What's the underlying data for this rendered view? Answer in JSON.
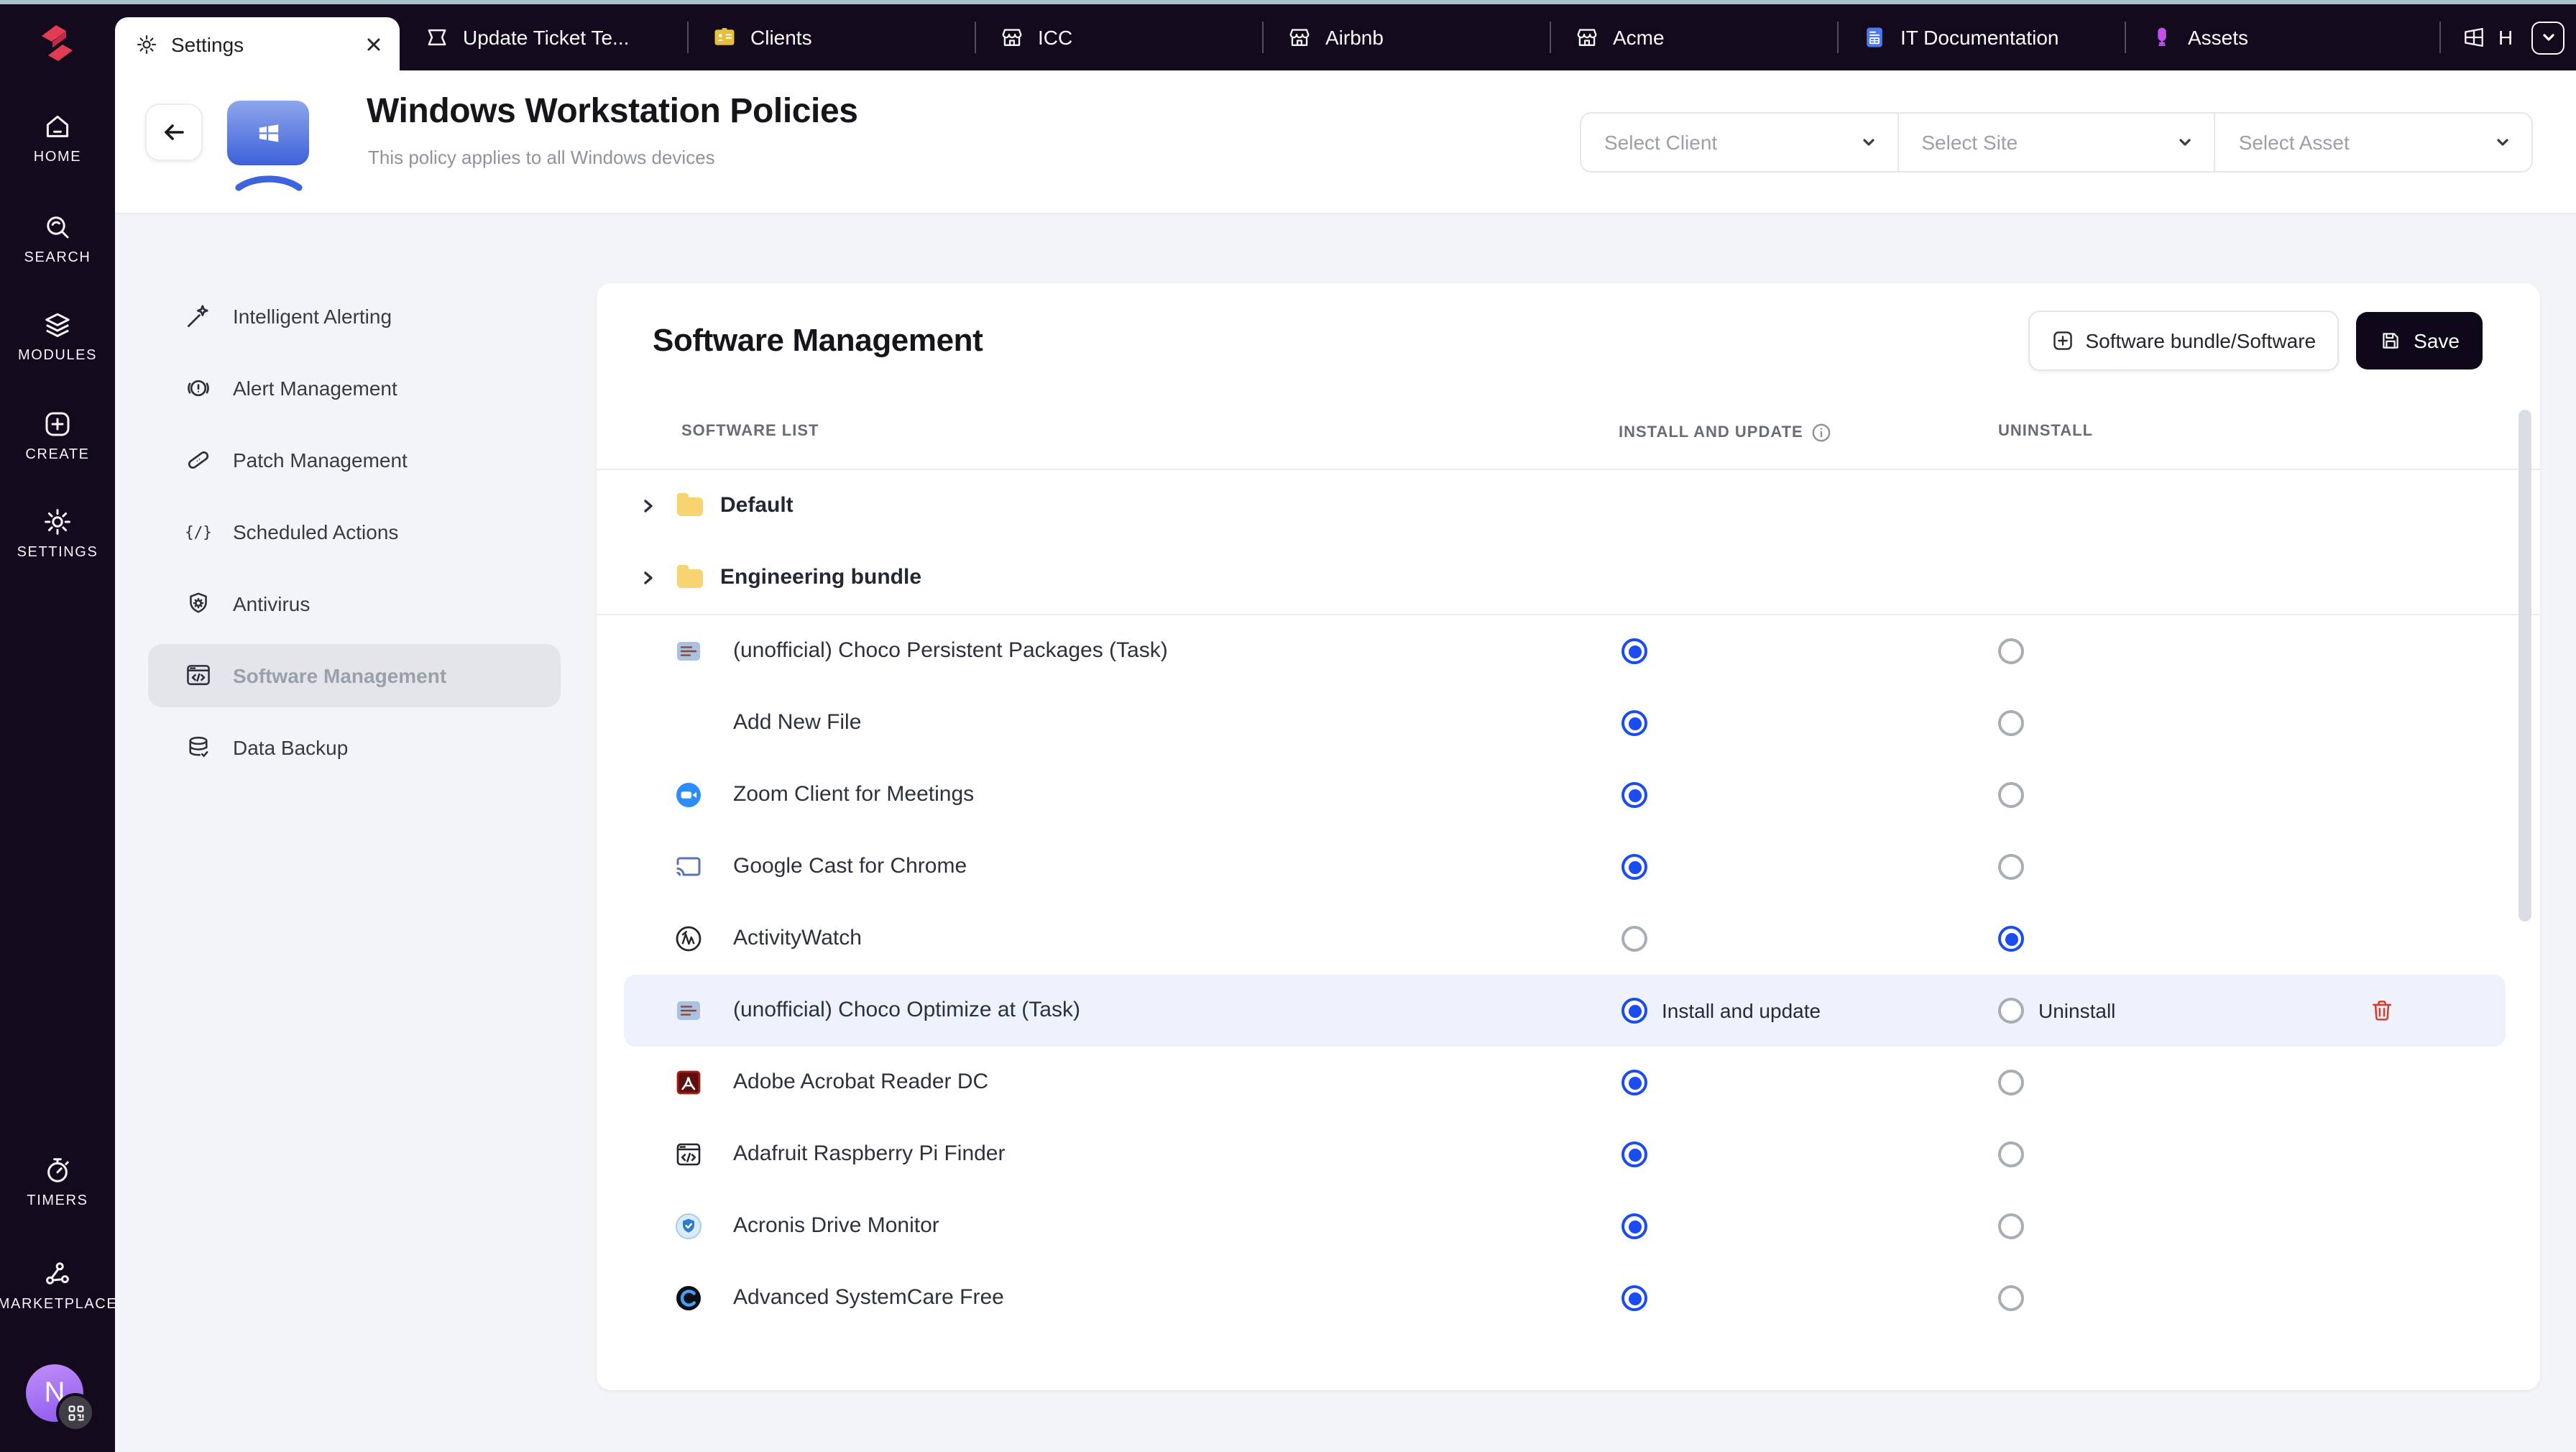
{
  "topbar": {
    "tabs": [
      {
        "label": "Settings",
        "icon": "gear-icon",
        "active": true,
        "closable": true
      },
      {
        "label": "Update Ticket Te...",
        "icon": "ticket-icon"
      },
      {
        "label": "Clients",
        "icon": "clients-badge-icon"
      },
      {
        "label": "ICC",
        "icon": "storefront-icon"
      },
      {
        "label": "Airbnb",
        "icon": "storefront-icon"
      },
      {
        "label": "Acme",
        "icon": "storefront-icon"
      },
      {
        "label": "IT Documentation",
        "icon": "document-icon"
      },
      {
        "label": "Assets",
        "icon": "assets-icon"
      }
    ],
    "overflow_tab": {
      "label": "H",
      "icon": "windows-grid-icon"
    },
    "tab_list_chevron": "chevron-down-icon"
  },
  "sidebar": {
    "items": [
      {
        "label": "HOME",
        "icon": "home-icon"
      },
      {
        "label": "SEARCH",
        "icon": "search-icon"
      },
      {
        "label": "MODULES",
        "icon": "layers-icon"
      },
      {
        "label": "CREATE",
        "icon": "plus-square-icon"
      },
      {
        "label": "SETTINGS",
        "icon": "gear-icon"
      },
      {
        "label": "TIMERS",
        "icon": "stopwatch-icon"
      },
      {
        "label": "MARKETPLACE",
        "icon": "nodes-icon"
      }
    ],
    "avatar": {
      "initial": "N",
      "badge_icon": "qr-code-icon"
    }
  },
  "header": {
    "title": "Windows Workstation Policies",
    "subtitle": "This policy applies to all Windows devices",
    "os_icon": "windows-icon",
    "selects": [
      {
        "placeholder": "Select Client"
      },
      {
        "placeholder": "Select Site"
      },
      {
        "placeholder": "Select Asset"
      }
    ]
  },
  "settings_nav": {
    "selected": "Software Management",
    "items": [
      {
        "label": "Intelligent Alerting",
        "icon": "magic-wand-icon"
      },
      {
        "label": "Alert Management",
        "icon": "alert-circle-icon"
      },
      {
        "label": "Patch Management",
        "icon": "bandage-icon"
      },
      {
        "label": "Scheduled Actions",
        "icon": "code-braces-icon"
      },
      {
        "label": "Antivirus",
        "icon": "shield-virus-icon"
      },
      {
        "label": "Software Management",
        "icon": "window-code-icon"
      },
      {
        "label": "Data Backup",
        "icon": "database-icon"
      }
    ]
  },
  "panel": {
    "title": "Software Management",
    "buttons": {
      "bundle_label": "Software bundle/Software",
      "save_label": "Save"
    },
    "columns": [
      "SOFTWARE LIST",
      "INSTALL AND UPDATE",
      "UNINSTALL"
    ],
    "folders": [
      {
        "name": "Default"
      },
      {
        "name": "Engineering bundle"
      }
    ],
    "rows": [
      {
        "name": "(unofficial) Choco Persistent Packages (Task)",
        "icon": "choco",
        "selected": "install"
      },
      {
        "name": "Add New File",
        "icon": "none",
        "selected": "install"
      },
      {
        "name": "Zoom Client for Meetings",
        "icon": "zoom",
        "selected": "install"
      },
      {
        "name": "Google Cast for Chrome",
        "icon": "cast",
        "selected": "install"
      },
      {
        "name": "ActivityWatch",
        "icon": "activitywatch",
        "selected": "uninstall"
      },
      {
        "name": "(unofficial) Choco Optimize at (Task)",
        "icon": "choco",
        "selected": "install",
        "highlighted": true,
        "install_label": "Install and update",
        "uninstall_label": "Uninstall",
        "delete_action": true
      },
      {
        "name": "Adobe Acrobat Reader DC",
        "icon": "adobe",
        "selected": "install"
      },
      {
        "name": "Adafruit Raspberry Pi Finder",
        "icon": "adafruit",
        "selected": "install"
      },
      {
        "name": "Acronis Drive Monitor",
        "icon": "acronis",
        "selected": "install"
      },
      {
        "name": "Advanced SystemCare Free",
        "icon": "systemcare",
        "selected": "install"
      }
    ]
  },
  "colors": {
    "topbar_bg": "#130b1d",
    "accent_blue": "#1a4cf0",
    "highlight_row": "#edf2fc",
    "folder_yellow": "#f7d471",
    "danger_red": "#df392b",
    "save_button_bg": "#0e0818",
    "content_bg": "#f3f4f7",
    "brand_red": "#e23c55"
  }
}
